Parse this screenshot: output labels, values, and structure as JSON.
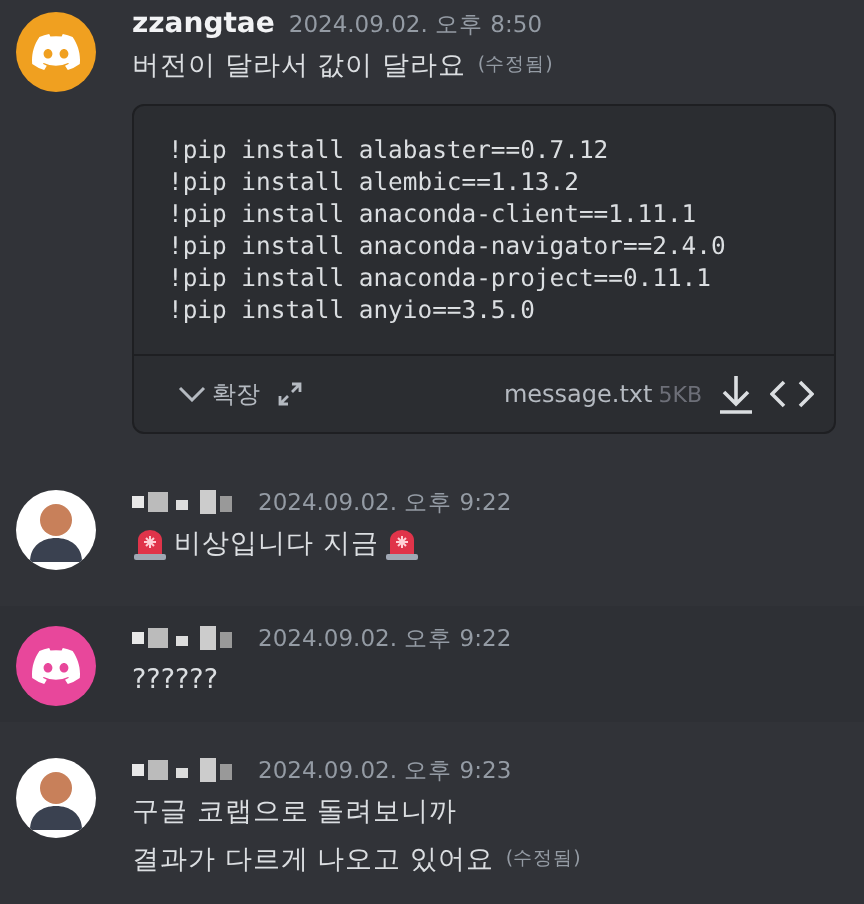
{
  "messages": [
    {
      "avatar": {
        "kind": "discord",
        "color": "#f0a020"
      },
      "name": "zzangtae",
      "name_redacted": false,
      "time": "2024.09.02. 오후 8:50",
      "hovered": false,
      "lines": [
        [
          {
            "kind": "text",
            "text": "버전이 달라서 값이 달라요"
          },
          {
            "kind": "edited",
            "text": "(수정됨)"
          }
        ]
      ],
      "attachment": {
        "code": [
          "!pip install alabaster==0.7.12",
          "!pip install alembic==1.13.2",
          "!pip install anaconda-client==1.11.1",
          "!pip install anaconda-navigator==2.4.0",
          "!pip install anaconda-project==0.11.1",
          "!pip install anyio==3.5.0"
        ],
        "expand_label": "확장",
        "filename": "message.txt",
        "size": "5KB"
      }
    },
    {
      "avatar": {
        "kind": "person",
        "color": "#ffffff"
      },
      "name_redacted": true,
      "time": "2024.09.02. 오후 9:22",
      "hovered": false,
      "lines": [
        [
          {
            "kind": "siren"
          },
          {
            "kind": "text",
            "text": "비상입니다 지금"
          },
          {
            "kind": "siren"
          }
        ]
      ]
    },
    {
      "avatar": {
        "kind": "discord",
        "color": "#e8479b"
      },
      "name_redacted": true,
      "time": "2024.09.02. 오후 9:22",
      "hovered": true,
      "lines": [
        [
          {
            "kind": "text",
            "text": "??????"
          }
        ]
      ]
    },
    {
      "avatar": {
        "kind": "person",
        "color": "#ffffff"
      },
      "name_redacted": true,
      "time": "2024.09.02. 오후 9:23",
      "hovered": false,
      "lines": [
        [
          {
            "kind": "text",
            "text": "구글 코랩으로 돌려보니까"
          }
        ],
        [
          {
            "kind": "text",
            "text": "결과가 다르게 나오고 있어요"
          },
          {
            "kind": "edited",
            "text": "(수정됨)"
          }
        ]
      ]
    }
  ]
}
